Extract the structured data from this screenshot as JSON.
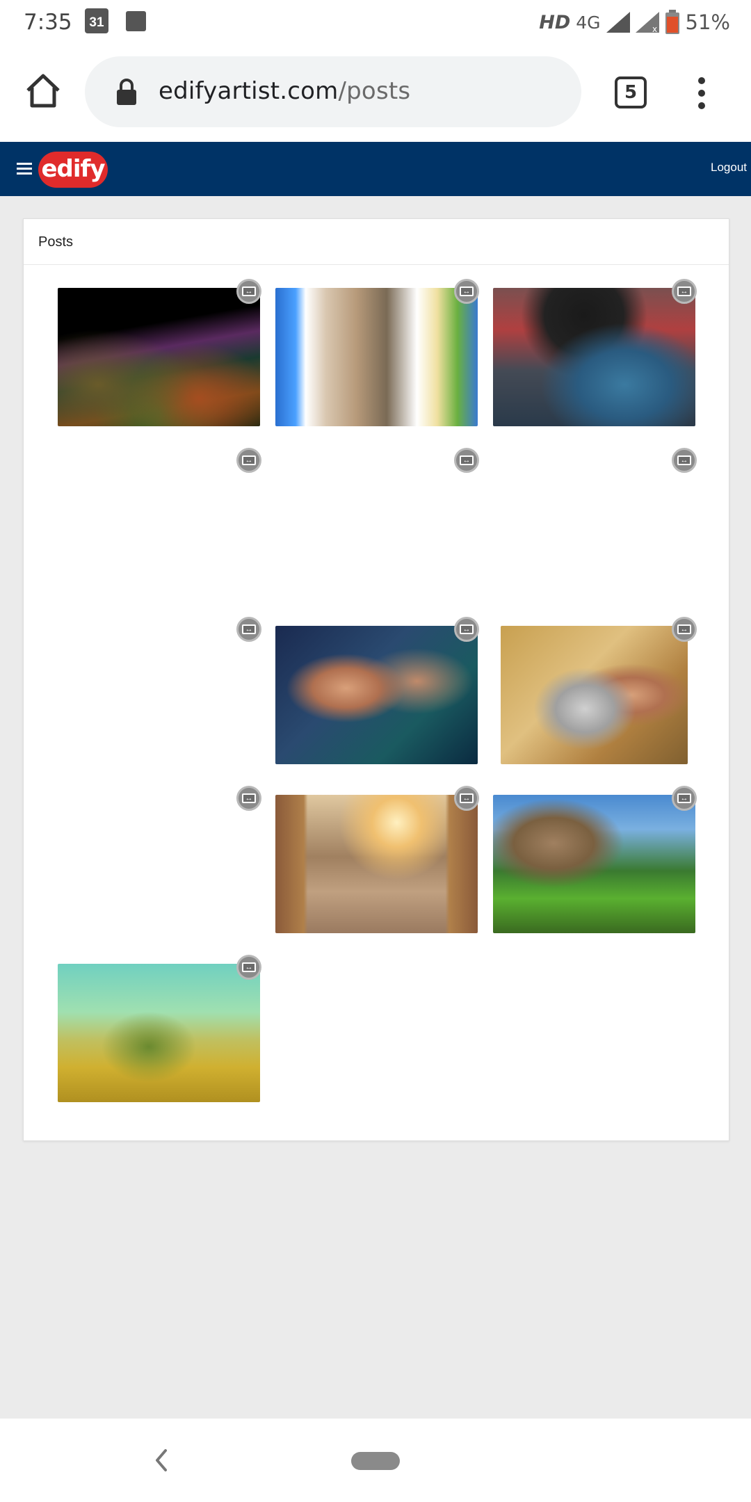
{
  "status_bar": {
    "time": "7:35",
    "calendar_day": "31",
    "network_label": "HD",
    "network_type": "4G",
    "battery_percent": "51%"
  },
  "browser": {
    "url_domain": "edifyartist.com",
    "url_path": "/posts",
    "tab_count": "5"
  },
  "app": {
    "logo_text": "edify",
    "logout_label": "Logout",
    "brand_color": "#003366",
    "logo_color": "#e02b2b"
  },
  "posts_panel": {
    "title": "Posts",
    "badge_icon": "resize-icon",
    "items": [
      {
        "image": "abstract-flowers-photo"
      },
      {
        "image": "woman-ruins-collage-photo"
      },
      {
        "image": "man-motorcycle-photo"
      },
      {
        "image": ""
      },
      {
        "image": ""
      },
      {
        "image": ""
      },
      {
        "image": ""
      },
      {
        "image": "couple-closeup-photo"
      },
      {
        "image": "couple-embrace-photo"
      },
      {
        "image": ""
      },
      {
        "image": "man-archway-photo"
      },
      {
        "image": "temple-garden-photo"
      },
      {
        "image": "tree-landscape-photo"
      }
    ]
  }
}
